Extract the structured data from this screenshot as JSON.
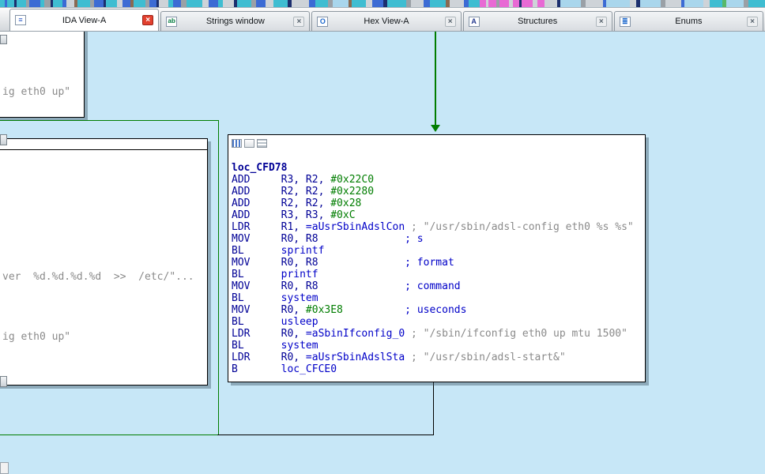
{
  "colors": {
    "canvas_bg": "#c7e7f7",
    "edge_green": "#007d00",
    "edge_black": "#000000",
    "node_border": "#000000",
    "active_close": "#e2402e"
  },
  "tabs": [
    {
      "label": "IDA View-A",
      "icon": "ida-view-icon",
      "glyph": "≡",
      "active": true,
      "close": "×"
    },
    {
      "label": "Strings window",
      "icon": "strings-icon",
      "glyph": "ab",
      "active": false,
      "close": "×"
    },
    {
      "label": "Hex View-A",
      "icon": "hex-icon",
      "glyph": "O",
      "active": false,
      "close": "×"
    },
    {
      "label": "Structures",
      "icon": "structures-icon",
      "glyph": "A",
      "active": false,
      "close": "×"
    },
    {
      "label": "Enums",
      "icon": "enums-icon",
      "glyph": "≣",
      "active": false,
      "close": "×"
    }
  ],
  "navband": {
    "stripes": [
      [
        6,
        "#3fbdd1"
      ],
      [
        3,
        "#3c6bd4"
      ],
      [
        9,
        "#3fbdd1"
      ],
      [
        3,
        "#1c2f6e"
      ],
      [
        12,
        "#3fbdd1"
      ],
      [
        4,
        "#9aa0a6"
      ],
      [
        14,
        "#3c6bd4"
      ],
      [
        5,
        "#3fbdd1"
      ],
      [
        8,
        "#9aa0a6"
      ],
      [
        3,
        "#1c2f6e"
      ],
      [
        12,
        "#3fbdd1"
      ],
      [
        5,
        "#3c6bd4"
      ],
      [
        10,
        "#ced3d8"
      ],
      [
        4,
        "#8a6a52"
      ],
      [
        16,
        "#3fbdd1"
      ],
      [
        5,
        "#9aa0a6"
      ],
      [
        12,
        "#3c6bd4"
      ],
      [
        3,
        "#1c2f6e"
      ],
      [
        14,
        "#3fbdd1"
      ],
      [
        7,
        "#ced3d8"
      ],
      [
        10,
        "#3c6bd4"
      ],
      [
        4,
        "#8a6a52"
      ],
      [
        15,
        "#3fbdd1"
      ],
      [
        5,
        "#9aa0a6"
      ],
      [
        9,
        "#3c6bd4"
      ],
      [
        3,
        "#1c2f6e"
      ],
      [
        12,
        "#ced3d8"
      ],
      [
        6,
        "#3fbdd1"
      ],
      [
        10,
        "#3c6bd4"
      ],
      [
        7,
        "#9aa0a6"
      ],
      [
        20,
        "#3fbdd1"
      ],
      [
        8,
        "#ced3d8"
      ],
      [
        12,
        "#3c6bd4"
      ],
      [
        6,
        "#3fbdd1"
      ],
      [
        14,
        "#ced3d8"
      ],
      [
        4,
        "#1c2f6e"
      ],
      [
        18,
        "#3fbdd1"
      ],
      [
        6,
        "#9aa0a6"
      ],
      [
        12,
        "#3c6bd4"
      ],
      [
        10,
        "#ced3d8"
      ],
      [
        18,
        "#3fbdd1"
      ],
      [
        5,
        "#1c2f6e"
      ],
      [
        22,
        "#ced3d8"
      ],
      [
        8,
        "#3c6bd4"
      ],
      [
        16,
        "#3fbdd1"
      ],
      [
        6,
        "#9aa0a6"
      ],
      [
        20,
        "#a9d6ec"
      ],
      [
        4,
        "#8a6a52"
      ],
      [
        18,
        "#3fbdd1"
      ],
      [
        8,
        "#ced3d8"
      ],
      [
        14,
        "#3c6bd4"
      ],
      [
        5,
        "#1c2f6e"
      ],
      [
        24,
        "#3fbdd1"
      ],
      [
        6,
        "#9aa0a6"
      ],
      [
        16,
        "#ced3d8"
      ],
      [
        8,
        "#3c6bd4"
      ],
      [
        20,
        "#3fbdd1"
      ],
      [
        5,
        "#8a6a52"
      ],
      [
        18,
        "#ced3d8"
      ],
      [
        6,
        "#3c6bd4"
      ],
      [
        14,
        "#3fbdd1"
      ],
      [
        8,
        "#e86ad4"
      ],
      [
        3,
        "#ced3d8"
      ],
      [
        10,
        "#e86ad4"
      ],
      [
        4,
        "#9aa0a6"
      ],
      [
        12,
        "#e86ad4"
      ],
      [
        5,
        "#ced3d8"
      ],
      [
        8,
        "#e86ad4"
      ],
      [
        3,
        "#1c2f6e"
      ],
      [
        14,
        "#e86ad4"
      ],
      [
        6,
        "#ced3d8"
      ],
      [
        9,
        "#e86ad4"
      ],
      [
        16,
        "#ced3d8"
      ],
      [
        4,
        "#1c2f6e"
      ],
      [
        26,
        "#a9d6ec"
      ],
      [
        6,
        "#9aa0a6"
      ],
      [
        22,
        "#ced3d8"
      ],
      [
        4,
        "#3c6bd4"
      ],
      [
        30,
        "#a9d6ec"
      ],
      [
        8,
        "#ced3d8"
      ],
      [
        5,
        "#1c2f6e"
      ],
      [
        26,
        "#a9d6ec"
      ],
      [
        6,
        "#9aa0a6"
      ],
      [
        20,
        "#ced3d8"
      ],
      [
        4,
        "#3c6bd4"
      ],
      [
        24,
        "#a9d6ec"
      ],
      [
        8,
        "#ced3d8"
      ],
      [
        16,
        "#3fbdd1"
      ],
      [
        5,
        "#58b868"
      ],
      [
        22,
        "#a9d6ec"
      ],
      [
        6,
        "#9aa0a6"
      ],
      [
        21,
        "#3fbdd1"
      ]
    ]
  },
  "graph": {
    "top_node": {
      "lines": [
        "ig eth0 up\""
      ]
    },
    "left_node": {
      "lines": [
        "ver  %d.%d.%d.%d  >>  /etc/\"...",
        "ig eth0 up\""
      ]
    },
    "main_node": {
      "header_icons": [
        "node-color-icon",
        "node-frame-icon",
        "node-group-icon"
      ],
      "lines": [
        [
          {
            "t": "loc_CFD78",
            "s": "label"
          }
        ],
        [
          {
            "t": "ADD     R3, R2, ",
            "s": "ins"
          },
          {
            "t": "#0x22C0",
            "s": "imm"
          }
        ],
        [
          {
            "t": "ADD     R2, R2, ",
            "s": "ins"
          },
          {
            "t": "#0x2280",
            "s": "imm"
          }
        ],
        [
          {
            "t": "ADD     R2, R2, ",
            "s": "ins"
          },
          {
            "t": "#0x28",
            "s": "imm"
          }
        ],
        [
          {
            "t": "ADD     R3, R3, ",
            "s": "ins"
          },
          {
            "t": "#0xC",
            "s": "imm"
          }
        ],
        [
          {
            "t": "LDR     R1, ",
            "s": "ins"
          },
          {
            "t": "=aUsrSbinAdslCon",
            "s": "name"
          },
          {
            "t": " ",
            "s": "ins"
          },
          {
            "t": "; \"/usr/sbin/adsl-config eth0 %s %s\"",
            "s": "str"
          }
        ],
        [
          {
            "t": "MOV     R0, R8              ",
            "s": "ins"
          },
          {
            "t": "; s",
            "s": "cmt"
          }
        ],
        [
          {
            "t": "BL      ",
            "s": "ins"
          },
          {
            "t": "sprintf",
            "s": "name"
          }
        ],
        [
          {
            "t": "MOV     R0, R8              ",
            "s": "ins"
          },
          {
            "t": "; format",
            "s": "cmt"
          }
        ],
        [
          {
            "t": "BL      ",
            "s": "ins"
          },
          {
            "t": "printf",
            "s": "name"
          }
        ],
        [
          {
            "t": "MOV     R0, R8              ",
            "s": "ins"
          },
          {
            "t": "; command",
            "s": "cmt"
          }
        ],
        [
          {
            "t": "BL      ",
            "s": "ins"
          },
          {
            "t": "system",
            "s": "name"
          }
        ],
        [
          {
            "t": "MOV     R0, ",
            "s": "ins"
          },
          {
            "t": "#0x3E8",
            "s": "imm"
          },
          {
            "t": "          ",
            "s": "ins"
          },
          {
            "t": "; useconds",
            "s": "cmt"
          }
        ],
        [
          {
            "t": "BL      ",
            "s": "ins"
          },
          {
            "t": "usleep",
            "s": "name"
          }
        ],
        [
          {
            "t": "LDR     R0, ",
            "s": "ins"
          },
          {
            "t": "=aSbinIfconfig_0",
            "s": "name"
          },
          {
            "t": " ",
            "s": "ins"
          },
          {
            "t": "; \"/sbin/ifconfig eth0 up mtu 1500\"",
            "s": "str"
          }
        ],
        [
          {
            "t": "BL      ",
            "s": "ins"
          },
          {
            "t": "system",
            "s": "name"
          }
        ],
        [
          {
            "t": "LDR     R0, ",
            "s": "ins"
          },
          {
            "t": "=aUsrSbinAdslSta",
            "s": "name"
          },
          {
            "t": " ",
            "s": "ins"
          },
          {
            "t": "; \"/usr/sbin/adsl-start&\"",
            "s": "str"
          }
        ],
        [
          {
            "t": "B       ",
            "s": "ins"
          },
          {
            "t": "loc_CFCE0",
            "s": "name"
          }
        ]
      ]
    }
  }
}
